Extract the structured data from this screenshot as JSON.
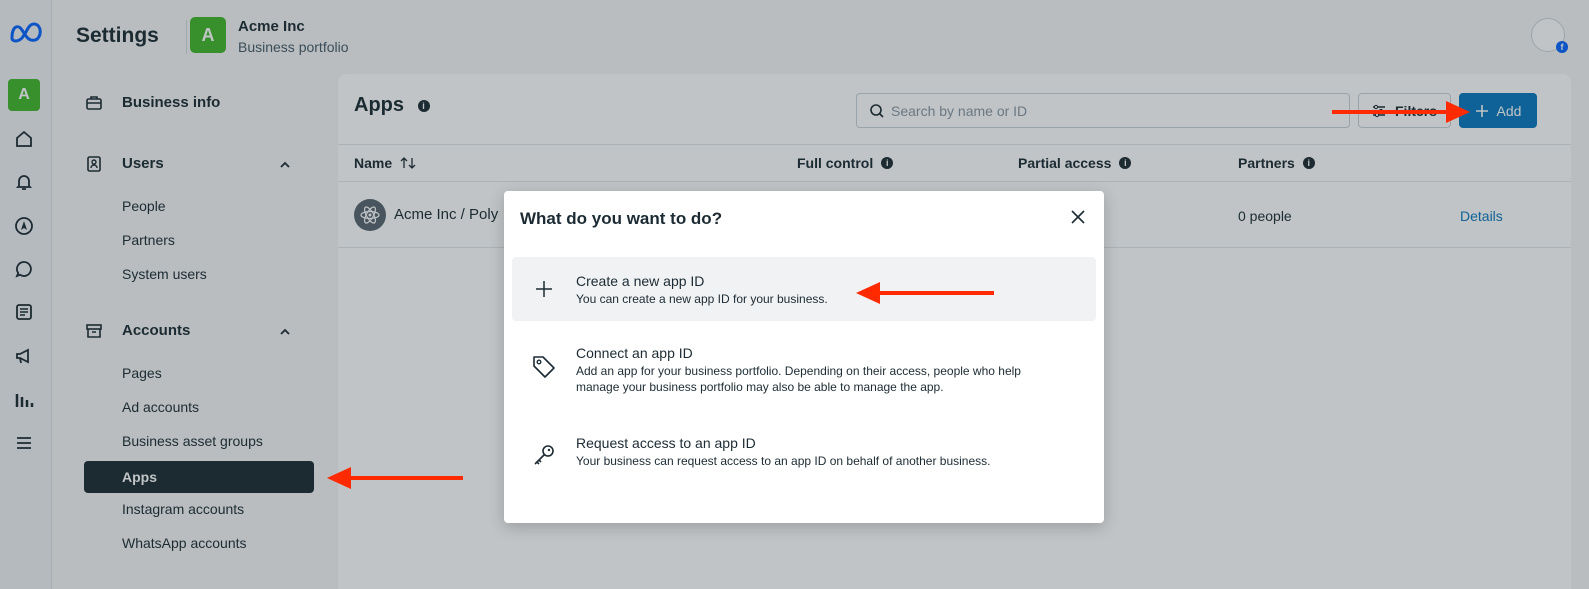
{
  "header": {
    "title": "Settings",
    "business_initial": "A",
    "business_name": "Acme Inc",
    "business_sub": "Business portfolio"
  },
  "rail": {
    "avatar_initial": "A"
  },
  "nav": {
    "business_info": "Business info",
    "users": {
      "label": "Users",
      "items": [
        "People",
        "Partners",
        "System users"
      ]
    },
    "accounts": {
      "label": "Accounts",
      "items": [
        "Pages",
        "Ad accounts",
        "Business asset groups",
        "Apps",
        "Instagram accounts",
        "WhatsApp accounts"
      ]
    }
  },
  "main": {
    "title": "Apps",
    "search_placeholder": "Search by name or ID",
    "filters_label": "Filters",
    "add_label": "Add",
    "columns": {
      "name": "Name",
      "full_control": "Full control",
      "partial_access": "Partial access",
      "partners": "Partners"
    },
    "row": {
      "name": "Acme Inc / Poly",
      "partners": "0 people",
      "details": "Details"
    }
  },
  "modal": {
    "title": "What do you want to do?",
    "options": [
      {
        "title": "Create a new app ID",
        "desc": "You can create a new app ID for your business."
      },
      {
        "title": "Connect an app ID",
        "desc": "Add an app for your business portfolio. Depending on their access, people who help manage your business portfolio may also be able to manage the app."
      },
      {
        "title": "Request access to an app ID",
        "desc": "Your business can request access to an app ID on behalf of another business."
      }
    ]
  },
  "colors": {
    "accent": "#0a78be",
    "arrow": "#ff2a00",
    "active_nav": "#1c2b33",
    "avatar": "#42b72a"
  }
}
